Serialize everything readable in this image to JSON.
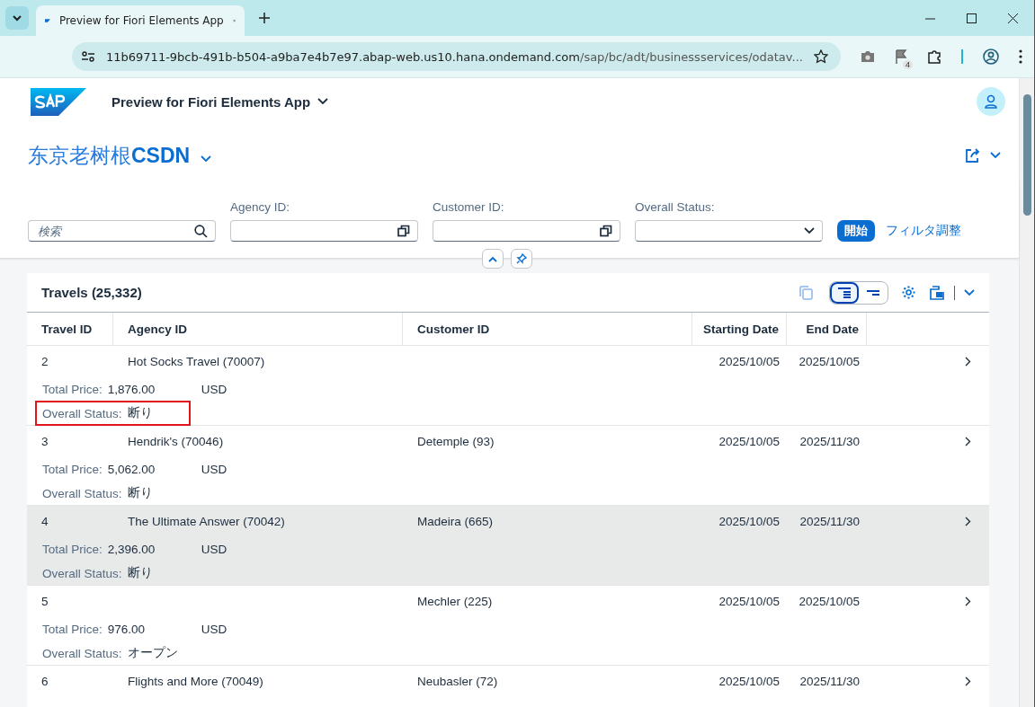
{
  "browser": {
    "tab_title": "Preview for Fiori Elements App",
    "url_host": "11b69711-9bcb-491b-b504-a9ba7e4b7e97.abap-web.us10.hana.ondemand.com",
    "url_path": "/sap/bc/adt/businessservices/odatav...",
    "flag_badge": "4"
  },
  "shell": {
    "title": "Preview for Fiori Elements App"
  },
  "page": {
    "title_plain": "东京老树根",
    "title_bold": "CSDN"
  },
  "filters": {
    "search": {
      "placeholder": "検索"
    },
    "fields": [
      {
        "label": "Agency ID:",
        "kind": "valuehelp"
      },
      {
        "label": "Customer ID:",
        "kind": "valuehelp"
      },
      {
        "label": "Overall Status:",
        "kind": "select"
      }
    ],
    "go": "開始",
    "adapt": "フィルタ調整"
  },
  "table": {
    "title": "Travels (25,332)",
    "columns": [
      "Travel ID",
      "Agency ID",
      "Customer ID",
      "Starting Date",
      "End Date"
    ],
    "rows": [
      {
        "travel_id": "2",
        "agency": "Hot Socks Travel (70007)",
        "customer": "",
        "start": "2025/10/05",
        "end": "2025/10/05",
        "price_label": "Total Price:",
        "price": "1,876.00",
        "currency": "USD",
        "status_label": "Overall Status:",
        "status": "断り",
        "selected": false,
        "marked": true
      },
      {
        "travel_id": "3",
        "agency": "Hendrik's (70046)",
        "customer": "Detemple (93)",
        "start": "2025/10/05",
        "end": "2025/11/30",
        "price_label": "Total Price:",
        "price": "5,062.00",
        "currency": "USD",
        "status_label": "Overall Status:",
        "status": "断り",
        "selected": false,
        "marked": false
      },
      {
        "travel_id": "4",
        "agency": "The Ultimate Answer (70042)",
        "customer": "Madeira (665)",
        "start": "2025/10/05",
        "end": "2025/11/30",
        "price_label": "Total Price:",
        "price": "2,396.00",
        "currency": "USD",
        "status_label": "Overall Status:",
        "status": "断り",
        "selected": true,
        "marked": false
      },
      {
        "travel_id": "5",
        "agency": "",
        "customer": "Mechler (225)",
        "start": "2025/10/05",
        "end": "2025/10/05",
        "price_label": "Total Price:",
        "price": "976.00",
        "currency": "USD",
        "status_label": "Overall Status:",
        "status": "オープン",
        "selected": false,
        "marked": false
      },
      {
        "travel_id": "6",
        "agency": "Flights and More (70049)",
        "customer": "Neubasler (72)",
        "start": "2025/10/05",
        "end": "2025/11/30",
        "selected": false
      }
    ]
  }
}
